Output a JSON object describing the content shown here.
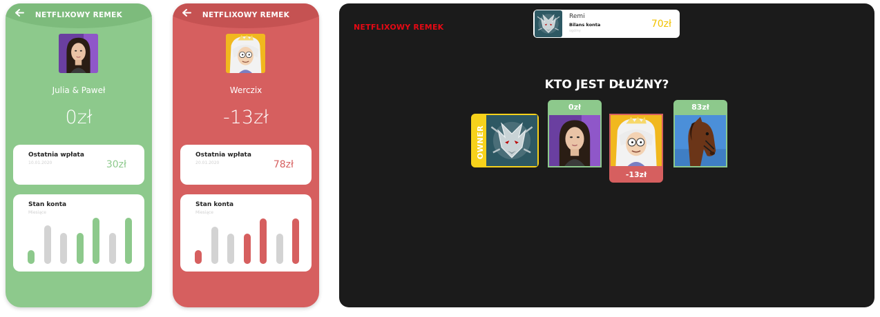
{
  "phones": [
    {
      "app_title": "NETFLIXOWY REMEK",
      "back_icon": "arrow-left-icon",
      "avatar": "portrait-dark-haired-woman",
      "name": "Julia & Paweł",
      "balance": "0zł",
      "last_payment": {
        "title": "Ostatnia wpłata",
        "date": "10.01.2020",
        "amount": "30zł"
      },
      "account": {
        "title": "Stan konta",
        "subtitle": "Miesiące",
        "bars": [
          0.3,
          0.82,
          0.66,
          0.66,
          0.98,
          0.66,
          0.98
        ],
        "highlight": [
          true,
          false,
          false,
          true,
          true,
          false,
          true
        ]
      },
      "color": "#8dc98c"
    },
    {
      "app_title": "NETFLIXOWY REMEK",
      "back_icon": "arrow-left-icon",
      "avatar": "cartoon-princess",
      "name": "Werczix",
      "balance": "-13zł",
      "last_payment": {
        "title": "Ostatnia wpłata",
        "date": "20.01.2020",
        "amount": "78zł"
      },
      "account": {
        "title": "Stan konta",
        "subtitle": "Miesiące",
        "bars": [
          0.3,
          0.8,
          0.64,
          0.64,
          0.97,
          0.64,
          0.97
        ],
        "highlight": [
          true,
          false,
          false,
          true,
          true,
          false,
          true
        ]
      },
      "color": "#d65f5f"
    }
  ],
  "tv": {
    "brand": "NETFLIXOWY REMEK",
    "user": {
      "name": "Remi",
      "label": "Bilans konta",
      "hint": "ogólny",
      "amount": "70zł",
      "avatar": "wolf-medallion-icon"
    },
    "question": "KTO JEST DŁUŻNY?",
    "members": [
      {
        "avatar": "wolf-medallion",
        "badge": "OWNER",
        "badge_pos": "left",
        "badge_color": "#f7d21b"
      },
      {
        "avatar": "portrait-dark-haired-woman",
        "badge": "0zł",
        "badge_pos": "top",
        "badge_color": "#8dc98c"
      },
      {
        "avatar": "cartoon-princess",
        "badge": "-13zł",
        "badge_pos": "bottom",
        "badge_color": "#d65f5f"
      },
      {
        "avatar": "horse",
        "badge": "83zł",
        "badge_pos": "top",
        "badge_color": "#8dc98c"
      }
    ],
    "accent_red": "#e50914",
    "accent_yellow": "#f2c200"
  }
}
